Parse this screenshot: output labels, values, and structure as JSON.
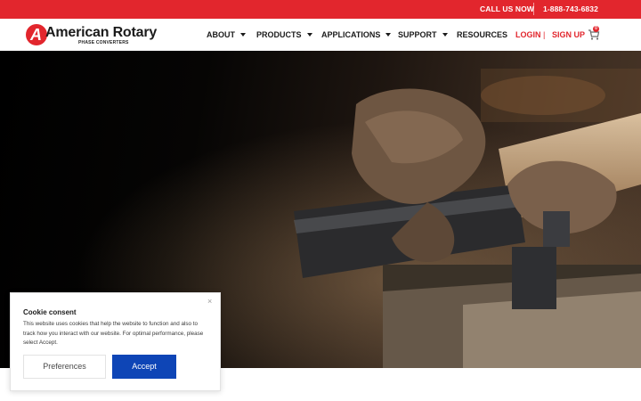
{
  "topbar": {
    "call_label": "CALL US NOW",
    "phone": "1-888-743-6832"
  },
  "logo": {
    "letter": "A",
    "name": "American Rotary",
    "tagline": "PHASE CONVERTERS"
  },
  "nav": {
    "items": [
      {
        "label": "ABOUT",
        "dropdown": true
      },
      {
        "label": "PRODUCTS",
        "dropdown": true
      },
      {
        "label": "APPLICATIONS",
        "dropdown": true
      },
      {
        "label": "SUPPORT",
        "dropdown": true
      },
      {
        "label": "RESOURCES",
        "dropdown": false
      }
    ]
  },
  "auth": {
    "login": "LOGIN",
    "separator": "|",
    "signup": "SIGN UP"
  },
  "cart": {
    "count": "0",
    "icon": "cart-icon"
  },
  "cookie": {
    "close": "×",
    "title": "Cookie consent",
    "body": "This website uses cookies that help the website to function and also to track how you interact with our website. For optimal performance, please select Accept.",
    "preferences": "Preferences",
    "accept": "Accept"
  },
  "colors": {
    "brand_red": "#e2262d",
    "accept_blue": "#0e45b6",
    "text_dark": "#1b1b1b"
  }
}
